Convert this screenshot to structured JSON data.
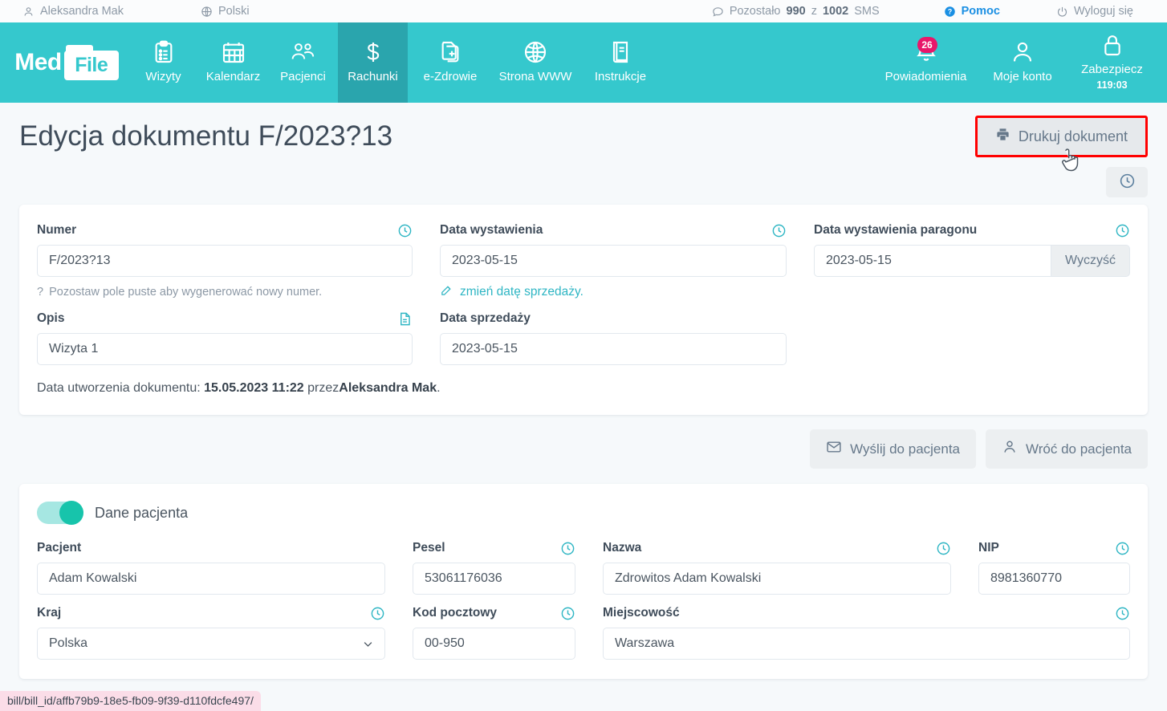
{
  "topbar": {
    "user": "Aleksandra Mak",
    "language": "Polski",
    "sms_prefix": "Pozostało",
    "sms_count": "990",
    "sms_mid": "z",
    "sms_total": "1002",
    "sms_suffix": "SMS",
    "help": "Pomoc",
    "logout": "Wyloguj się"
  },
  "brand": {
    "med": "Med",
    "file": "File"
  },
  "nav": {
    "items": [
      {
        "label": "Wizyty",
        "icon": "clipboard-icon",
        "active": false
      },
      {
        "label": "Kalendarz",
        "icon": "calendar-icon",
        "active": false
      },
      {
        "label": "Pacjenci",
        "icon": "people-icon",
        "active": false
      },
      {
        "label": "Rachunki",
        "icon": "dollar-icon",
        "active": true
      },
      {
        "label": "e-Zdrowie",
        "icon": "health-doc-icon",
        "active": false
      },
      {
        "label": "Strona WWW",
        "icon": "globe-icon",
        "active": false
      },
      {
        "label": "Instrukcje",
        "icon": "book-icon",
        "active": false
      }
    ],
    "right": {
      "notifications_label": "Powiadomienia",
      "notifications_count": "26",
      "account_label": "Moje konto",
      "secure_label": "Zabezpiecz",
      "secure_timer": "119:03"
    }
  },
  "page": {
    "title": "Edycja dokumentu F/2023?13",
    "print_button": "Drukuj dokument",
    "history_button_icon": "clock-icon"
  },
  "document_card": {
    "numer": {
      "label": "Numer",
      "value": "F/2023?13",
      "hint": "Pozostaw pole puste aby wygenerować nowy numer."
    },
    "data_wystawienia": {
      "label": "Data wystawienia",
      "value": "2023-05-15",
      "link": "zmień datę sprzedaży."
    },
    "data_paragonu": {
      "label": "Data wystawienia paragonu",
      "value": "2023-05-15",
      "clear_button": "Wyczyść"
    },
    "opis": {
      "label": "Opis",
      "value": "Wizyta 1"
    },
    "data_sprzedazy": {
      "label": "Data sprzedaży",
      "value": "2023-05-15"
    },
    "created": {
      "prefix": "Data utworzenia dokumentu:",
      "datetime": "15.05.2023 11:22",
      "middle": "przez",
      "author": "Aleksandra Mak",
      "suffix": "."
    }
  },
  "actions": {
    "send_to_patient": "Wyślij do pacjenta",
    "back_to_patient": "Wróć do pacjenta"
  },
  "patient_card": {
    "toggle_label": "Dane pacjenta",
    "toggle_on": true,
    "pacjent": {
      "label": "Pacjent",
      "value": "Adam Kowalski"
    },
    "pesel": {
      "label": "Pesel",
      "value": "53061176036"
    },
    "nazwa": {
      "label": "Nazwa",
      "value": "Zdrowitos Adam Kowalski"
    },
    "nip": {
      "label": "NIP",
      "value": "8981360770"
    },
    "kraj": {
      "label": "Kraj",
      "value": "Polska"
    },
    "kod_pocztowy": {
      "label": "Kod pocztowy",
      "value": "00-950"
    },
    "miejscowosc": {
      "label": "Miejscowość",
      "value": "Warszawa"
    }
  },
  "status_bar": {
    "url": "bill/bill_id/affb79b9-18e5-fb09-9f39-d110fdcfe497/"
  },
  "colors": {
    "teal": "#35c8cd",
    "teal_active": "#2aa5ad",
    "accent_icon": "#2fb6c4",
    "badge": "#e8176a",
    "highlight": "#ff0000",
    "link_blue": "#1a8fe3",
    "toggle_on": "#17c4ab"
  }
}
